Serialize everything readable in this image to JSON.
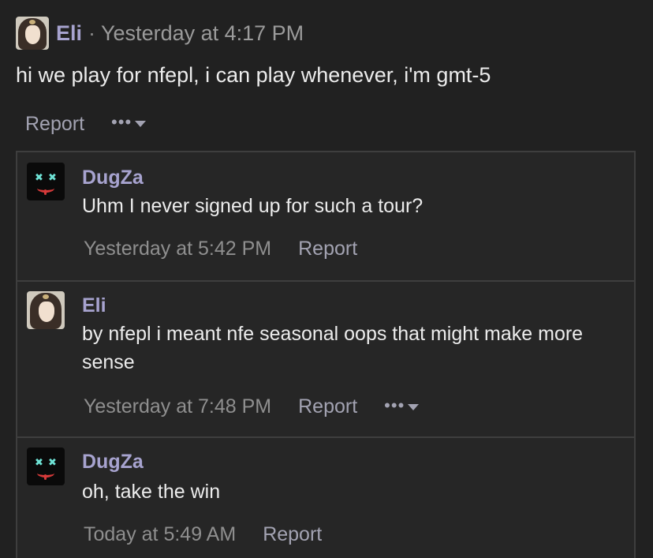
{
  "post": {
    "author": "Eli",
    "separator": "·",
    "time": "Yesterday at 4:17 PM",
    "body": "hi we play for nfepl, i can play whenever, i'm gmt-5",
    "report_label": "Report",
    "more_label": "•••"
  },
  "comments": [
    {
      "author": "DugZa",
      "text": "Uhm I never signed up for such a tour?",
      "time": "Yesterday at 5:42 PM",
      "report_label": "Report"
    },
    {
      "author": "Eli",
      "text": "by nfepl i meant nfe seasonal oops that might make more sense",
      "time": "Yesterday at 7:48 PM",
      "report_label": "Report",
      "more_label": "•••"
    },
    {
      "author": "DugZa",
      "text": "oh, take the win",
      "time": "Today at 5:49 AM",
      "report_label": "Report"
    }
  ]
}
